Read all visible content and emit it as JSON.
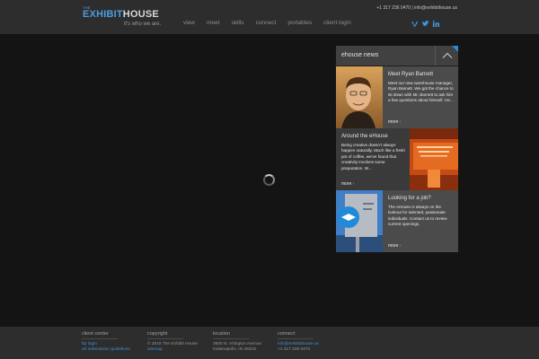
{
  "header": {
    "logo": {
      "the": "THE",
      "name_a": "EXHIBIT",
      "name_b": "HOUSE",
      "tagline": "it's who we are."
    },
    "contact": "+1 317 236 0470 | info@exhibithouse.us",
    "nav": [
      "view",
      "meet",
      "skills",
      "connect",
      "portables",
      "client login"
    ],
    "social": [
      "vimeo-icon",
      "twitter-icon",
      "linkedin-icon"
    ]
  },
  "news": {
    "title": "ehouse news",
    "items": [
      {
        "title": "Meet Ryan Barnett",
        "body": "Meet our new warehouse manager, Ryan Barnett. We got the chance to sit down with Mr. Barnett to ask him a few questions about himself. He...",
        "more": "more"
      },
      {
        "title": "Around the eHouse",
        "body": "Being creative doesn't always happen naturally. Much like a fresh pot of coffee, we've found that creativity involves some preparation. W...",
        "more": "more"
      },
      {
        "title": "Looking for a job?",
        "body": "The eHouse is always on the lookout for talented, passionate individuals. Contact us to review current openings.",
        "more": "more"
      }
    ]
  },
  "footer": {
    "client_center": {
      "heading": "client center",
      "links": [
        "ftp login",
        "art submission guidelines"
      ]
    },
    "copyright": {
      "heading": "copyright",
      "text": "© 2015 The Exhibit House",
      "link": "sitemap"
    },
    "location": {
      "heading": "location",
      "line1": "3500 N. Arlington Avenue",
      "line2": "Indianapolis, IN 46218"
    },
    "connect": {
      "heading": "connect",
      "email": "info@exhibithouse.us",
      "phone": "+1 317 236 0470"
    }
  },
  "colors": {
    "accent": "#3b9ae6",
    "header_bg": "#2d2d2d",
    "page_bg": "#141414"
  }
}
